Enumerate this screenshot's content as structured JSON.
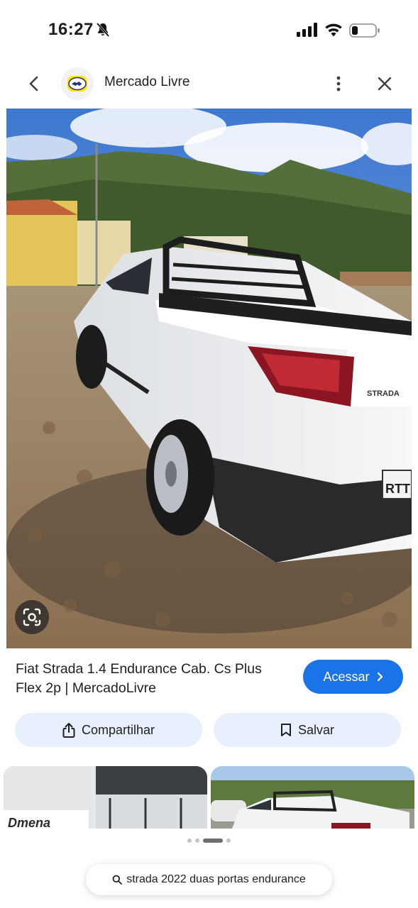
{
  "status_bar": {
    "time": "16:27",
    "icons": [
      "bell-muted-icon",
      "cellular-signal-icon",
      "wifi-icon",
      "battery-icon"
    ]
  },
  "header": {
    "site_name": "Mercado Livre",
    "icons": [
      "back-arrow-icon",
      "mercado-livre-logo",
      "more-vert-icon",
      "close-icon"
    ]
  },
  "hero_image": {
    "description_icon": "car-photo",
    "plate_text": "RTT",
    "badge_text": "STRADA",
    "lens_icon": "google-lens-icon"
  },
  "result": {
    "title": "Fiat Strada 1.4 Endurance Cab. Cs Plus Flex 2p | MercadoLivre",
    "visit_label": "Acessar",
    "visit_icon": "chevron-right-icon"
  },
  "actions": {
    "share_label": "Compartilhar",
    "share_icon": "share-icon",
    "save_label": "Salvar",
    "save_icon": "bookmark-icon"
  },
  "related": {
    "thumb_1_text": "Dmena",
    "thumbs": [
      "related-image-1",
      "related-image-2"
    ]
  },
  "pager": {
    "count": 4,
    "active_index": 2
  },
  "search": {
    "query": "strada 2022 duas portas endurance",
    "icon": "search-icon"
  },
  "colors": {
    "accent": "#1a73e8",
    "pill_bg": "#e8f0fe",
    "logo_yellow": "#ffe600"
  }
}
